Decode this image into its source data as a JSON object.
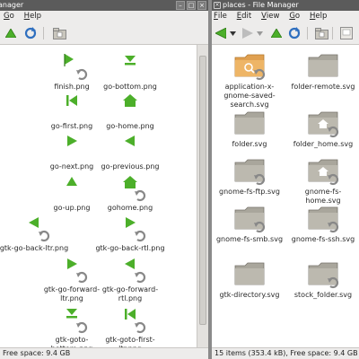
{
  "left_window": {
    "title": "anager",
    "menu": [
      {
        "label": "Go",
        "u": "G",
        "rest": "o"
      },
      {
        "label": "Help",
        "u": "H",
        "rest": "elp"
      }
    ],
    "items": [
      {
        "label": "finish.png",
        "icon": "finish-icon"
      },
      {
        "label": "go-bottom.png",
        "icon": "go-bottom-icon"
      },
      {
        "label": "go-first.png",
        "icon": "go-first-icon"
      },
      {
        "label": "go-home.png",
        "icon": "go-home-icon"
      },
      {
        "label": "go-next.png",
        "icon": "go-next-icon"
      },
      {
        "label": "go-previous.png",
        "icon": "go-previous-icon"
      },
      {
        "label": "go-up.png",
        "icon": "go-up-icon"
      },
      {
        "label": "gohome.png",
        "icon": "gohome-icon"
      },
      {
        "label": "gtk-go-back-ltr.png",
        "icon": "gtk-go-back-ltr-icon"
      },
      {
        "label": "gtk-go-back-rtl.png",
        "icon": "gtk-go-back-rtl-icon"
      },
      {
        "label": "gtk-go-forward-\nltr.png",
        "icon": "gtk-go-forward-ltr-icon"
      },
      {
        "label": "gtk-go-forward-\nrtl.png",
        "icon": "gtk-go-forward-rtl-icon"
      },
      {
        "label": "gtk-goto-\nbottom.png",
        "icon": "gtk-goto-bottom-icon"
      },
      {
        "label": "gtk-goto-first-\nltr.png",
        "icon": "gtk-goto-first-ltr-icon"
      }
    ],
    "status": "Free space: 9.4 GB"
  },
  "right_window": {
    "title": "places - File Manager",
    "menu": [
      {
        "label": "Edit",
        "u": "E",
        "rest": "dit"
      },
      {
        "label": "View",
        "u": "V",
        "rest": "iew"
      },
      {
        "label": "Go",
        "u": "G",
        "rest": "o"
      },
      {
        "label": "Help",
        "u": "H",
        "rest": "elp"
      }
    ],
    "menu_lead": "Edit",
    "items": [
      {
        "label": "application-x-\ngnome-saved-\nsearch.svg",
        "icon": "saved-search-folder-icon"
      },
      {
        "label": "folder-remote.svg",
        "icon": "folder-remote-icon"
      },
      {
        "label": "folder.svg",
        "icon": "folder-icon"
      },
      {
        "label": "folder_home.svg",
        "icon": "folder-home-icon"
      },
      {
        "label": "gnome-fs-ftp.svg",
        "icon": "ftp-folder-icon"
      },
      {
        "label": "gnome-fs-\nhome.svg",
        "icon": "fs-home-folder-icon"
      },
      {
        "label": "gnome-fs-smb.svg",
        "icon": "smb-folder-icon"
      },
      {
        "label": "gnome-fs-ssh.svg",
        "icon": "ssh-folder-icon"
      },
      {
        "label": "gtk-directory.svg",
        "icon": "directory-folder-icon"
      },
      {
        "label": "stock_folder.svg",
        "icon": "stock-folder-icon"
      }
    ],
    "status": "15 items (353.4 kB), Free space: 9.4 GB"
  },
  "colors": {
    "titlebar": "#5b5b5b",
    "arrow_green": "#4caf2a",
    "folder": "#a9a69c",
    "folder_orange": "#e0a050"
  }
}
